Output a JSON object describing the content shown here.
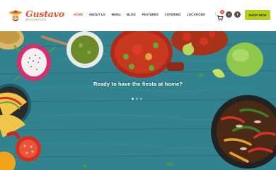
{
  "brand": {
    "name": "Gustavo",
    "tagline": "MEXICAN FOOD",
    "accent_color": "#e8502f"
  },
  "nav": {
    "items": [
      {
        "label": "HOME",
        "active": true
      },
      {
        "label": "ABOUT US",
        "active": false
      },
      {
        "label": "MENU",
        "active": false
      },
      {
        "label": "BLOG",
        "active": false
      },
      {
        "label": "FEATURES",
        "active": false
      },
      {
        "label": "CATERING",
        "active": false
      },
      {
        "label": "LOCATIONS",
        "active": false
      }
    ],
    "more_icon": "more-vertical-icon"
  },
  "header_actions": {
    "cart_icon": "shopping-cart-icon",
    "cart_count": "0",
    "social": [
      {
        "icon": "twitter-icon",
        "glyph": "t"
      },
      {
        "icon": "facebook-icon",
        "glyph": "f"
      }
    ],
    "shop_button_label": "SHOP NOW",
    "shop_button_color": "#b7cc1c"
  },
  "hero": {
    "title": "Ready to have the fiesta at home?",
    "slide_count": 3,
    "active_slide": 1,
    "table_color": "#3d9aa6"
  }
}
